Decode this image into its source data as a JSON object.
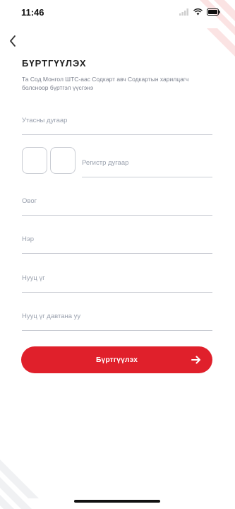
{
  "status_bar": {
    "time": "11:46",
    "wifi_icon": "wifi-icon",
    "battery_icon": "battery-icon"
  },
  "header": {
    "back_icon": "chevron-left-icon"
  },
  "page": {
    "title": "БҮРТГҮҮЛЭХ",
    "subtitle": "Та Сод Монгол ШТС-аас Содкарт авч Содкартын харилцагч болсноор бүртгэл үүсгэнэ"
  },
  "form": {
    "phone_placeholder": "Утасны дугаар",
    "register_placeholder": "Регистр дугаар",
    "lastname_placeholder": "Овог",
    "firstname_placeholder": "Нэр",
    "password_placeholder": "Нууц үг",
    "password_repeat_placeholder": "Нууц үг давтана уу"
  },
  "submit": {
    "label": "Бүртгүүлэх",
    "icon": "arrow-right-icon"
  },
  "colors": {
    "accent": "#e0202b",
    "line": "#c9ccd3",
    "placeholder": "#9aa1ae"
  }
}
